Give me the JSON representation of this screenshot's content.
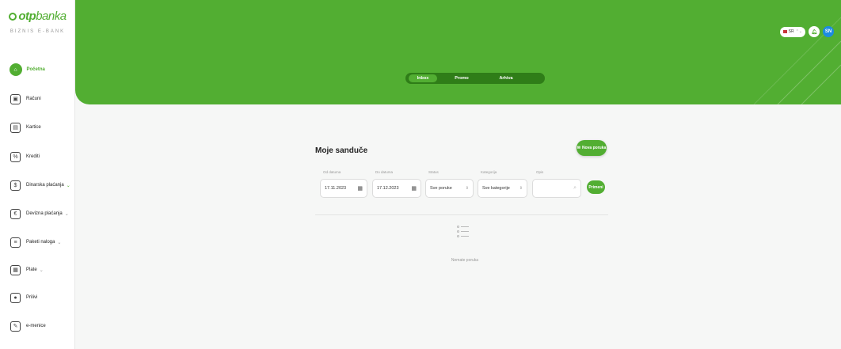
{
  "brand": {
    "logo_bold": "otp",
    "logo_light": "banka",
    "subtitle": "BIZNIS E-BANK",
    "color": "#52ae32"
  },
  "sidebar": {
    "items": [
      {
        "label": "Početna",
        "icon": "home-icon",
        "active": true
      },
      {
        "label": "Računi",
        "icon": "accounts-icon"
      },
      {
        "label": "Kartice",
        "icon": "cards-icon"
      },
      {
        "label": "Krediti",
        "icon": "loans-icon"
      },
      {
        "label": "Dinarska plaćanja",
        "icon": "dinar-payments-icon",
        "chevron": "⌄"
      },
      {
        "label": "Devizna plaćanja",
        "icon": "foreign-payments-icon",
        "chevron": "⌄"
      },
      {
        "label": "Paketi naloga",
        "icon": "order-packages-icon",
        "chevron": "⌄"
      },
      {
        "label": "Plate",
        "icon": "salaries-icon",
        "chevron": "⌄"
      },
      {
        "label": "Prilivi",
        "icon": "inflows-icon"
      },
      {
        "label": "e-menice",
        "icon": "e-bills-icon"
      }
    ]
  },
  "header": {
    "tabs": [
      {
        "label": "Inbox",
        "active": true
      },
      {
        "label": "Promo"
      },
      {
        "label": "Arhiva"
      }
    ],
    "lang": "SR",
    "lang_chevron": "⌃⌄",
    "avatar_initials": "SN"
  },
  "main": {
    "title": "Moje sandučе",
    "new_message_label": "Nova poruka",
    "filters": {
      "from_label": "Od datuma",
      "from_value": "17.11.2023",
      "to_label": "Do datuma",
      "to_value": "17.12.2023",
      "status_label": "Status",
      "status_value": "Sve poruke",
      "category_label": "Kategorija",
      "category_value": "Sve kategorije",
      "search_label": "Opis",
      "search_placeholder": "",
      "apply_label": "Primeni"
    },
    "empty_text": "Nemate poruka"
  }
}
